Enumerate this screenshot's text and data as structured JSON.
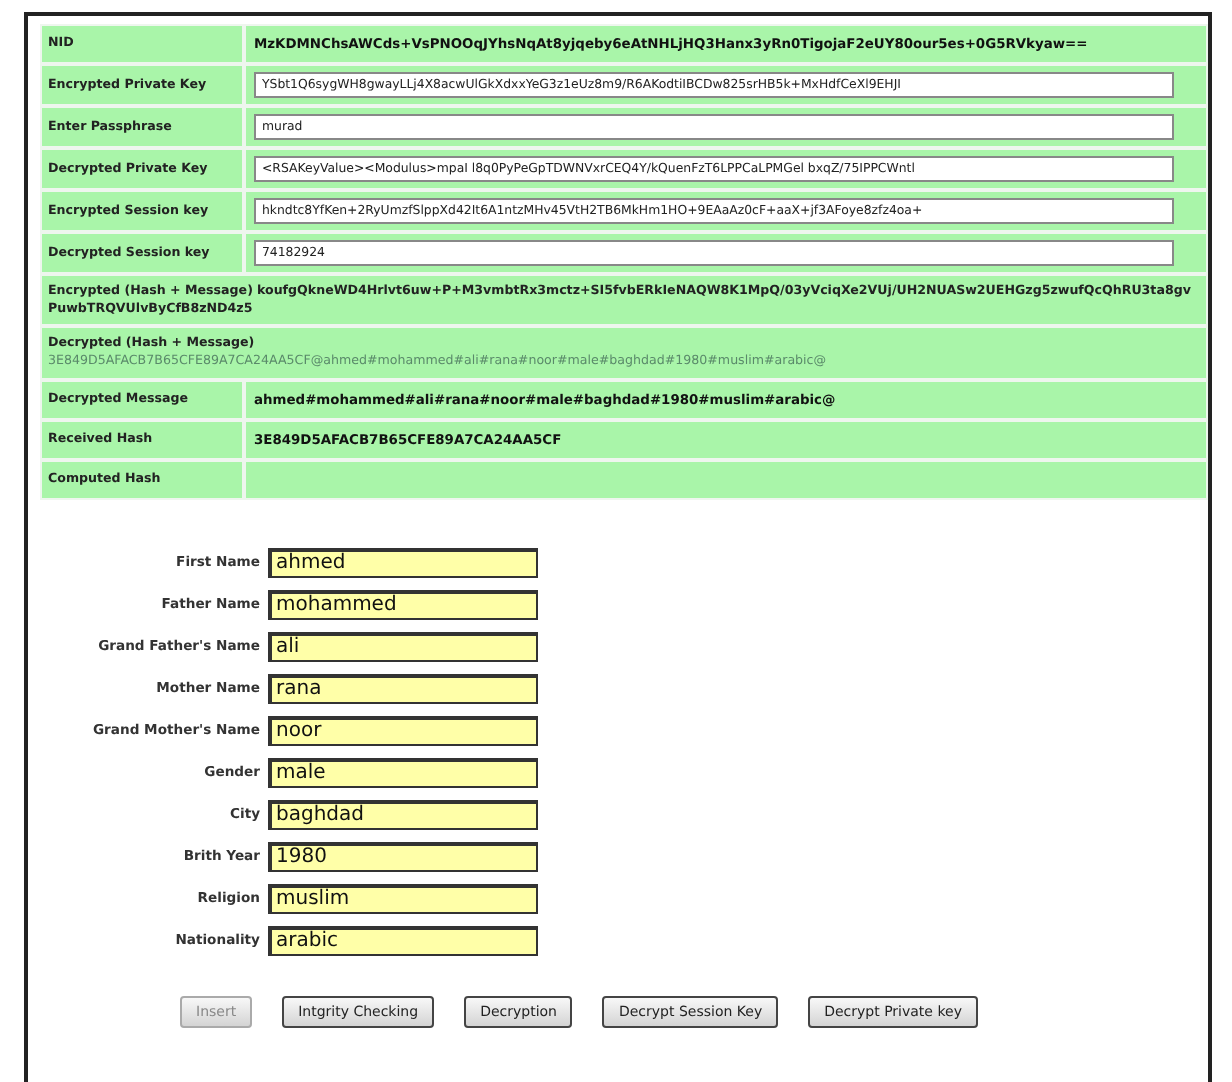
{
  "crypto_table": [
    {
      "kind": "text",
      "label": "NID",
      "value": "MzKDMNChsAWCds+VsPNOOqJYhsNqAt8yjqeby6eAtNHLjHQ3Hanx3yRn0TigojaF2eUY80our5es+0G5RVkyaw=="
    },
    {
      "kind": "field",
      "label": "Encrypted Private Key",
      "value": "YSbt1Q6sygWH8gwayLLj4X8acwUlGkXdxxYeG3z1eUz8m9/R6AKodtiIBCDw825srHB5k+MxHdfCeXl9EHJI"
    },
    {
      "kind": "field",
      "label": "Enter Passphrase",
      "value": "murad"
    },
    {
      "kind": "field",
      "label": "Decrypted Private Key",
      "value": "<RSAKeyValue><Modulus>mpaI l8q0PyPeGpTDWNVxrCEQ4Y/kQuenFzT6LPPCaLPMGel bxqZ/75IPPCWntl"
    },
    {
      "kind": "field",
      "label": "Encrypted Session key",
      "value": "hkndtc8YfKen+2RyUmzfSlppXd42It6A1ntzMHv45VtH2TB6MkHm1HO+9EAaAz0cF+aaX+jf3AFoye8zfz4oa+"
    },
    {
      "kind": "field",
      "label": "Decrypted Session key",
      "value": "74182924"
    },
    {
      "kind": "wide",
      "label": "Encrypted (Hash + Message)",
      "value": "koufgQkneWD4Hrlvt6uw+P+M3vmbtRx3mctz+SI5fvbERkIeNAQW8K1MpQ/03yVciqXe2VUj/UH2NUASw2UEHGzg5zwufQcQhRU3ta8gvPuwbTRQVUlvByCfB8zND4z5"
    },
    {
      "kind": "wide-below",
      "label": "Decrypted (Hash + Message)",
      "value": "3E849D5AFACB7B65CFE89A7CA24AA5CF@ahmed#mohammed#ali#rana#noor#male#baghdad#1980#muslim#arabic@"
    },
    {
      "kind": "text",
      "label": "Decrypted Message",
      "value": "ahmed#mohammed#ali#rana#noor#male#baghdad#1980#muslim#arabic@"
    },
    {
      "kind": "text",
      "label": "Received Hash",
      "value": "3E849D5AFACB7B65CFE89A7CA24AA5CF"
    },
    {
      "kind": "text",
      "label": "Computed Hash"
    }
  ],
  "form": [
    {
      "label": "First Name",
      "value": "ahmed"
    },
    {
      "label": "Father Name",
      "value": "mohammed"
    },
    {
      "label": "Grand Father's Name",
      "value": "ali"
    },
    {
      "label": "Mother Name",
      "value": "rana"
    },
    {
      "label": "Grand Mother's Name",
      "value": "noor"
    },
    {
      "label": "Gender",
      "value": "male"
    },
    {
      "label": "City",
      "value": "baghdad"
    },
    {
      "label": "Brith Year",
      "value": "1980"
    },
    {
      "label": "Religion",
      "value": "muslim"
    },
    {
      "label": "Nationality",
      "value": "arabic"
    }
  ],
  "buttons": [
    {
      "label": "Insert",
      "disabled": true
    },
    {
      "label": "Intgrity Checking",
      "disabled": false
    },
    {
      "label": "Decryption",
      "disabled": false
    },
    {
      "label": "Decrypt Session Key",
      "disabled": false
    },
    {
      "label": "Decrypt Private key",
      "disabled": false
    }
  ]
}
